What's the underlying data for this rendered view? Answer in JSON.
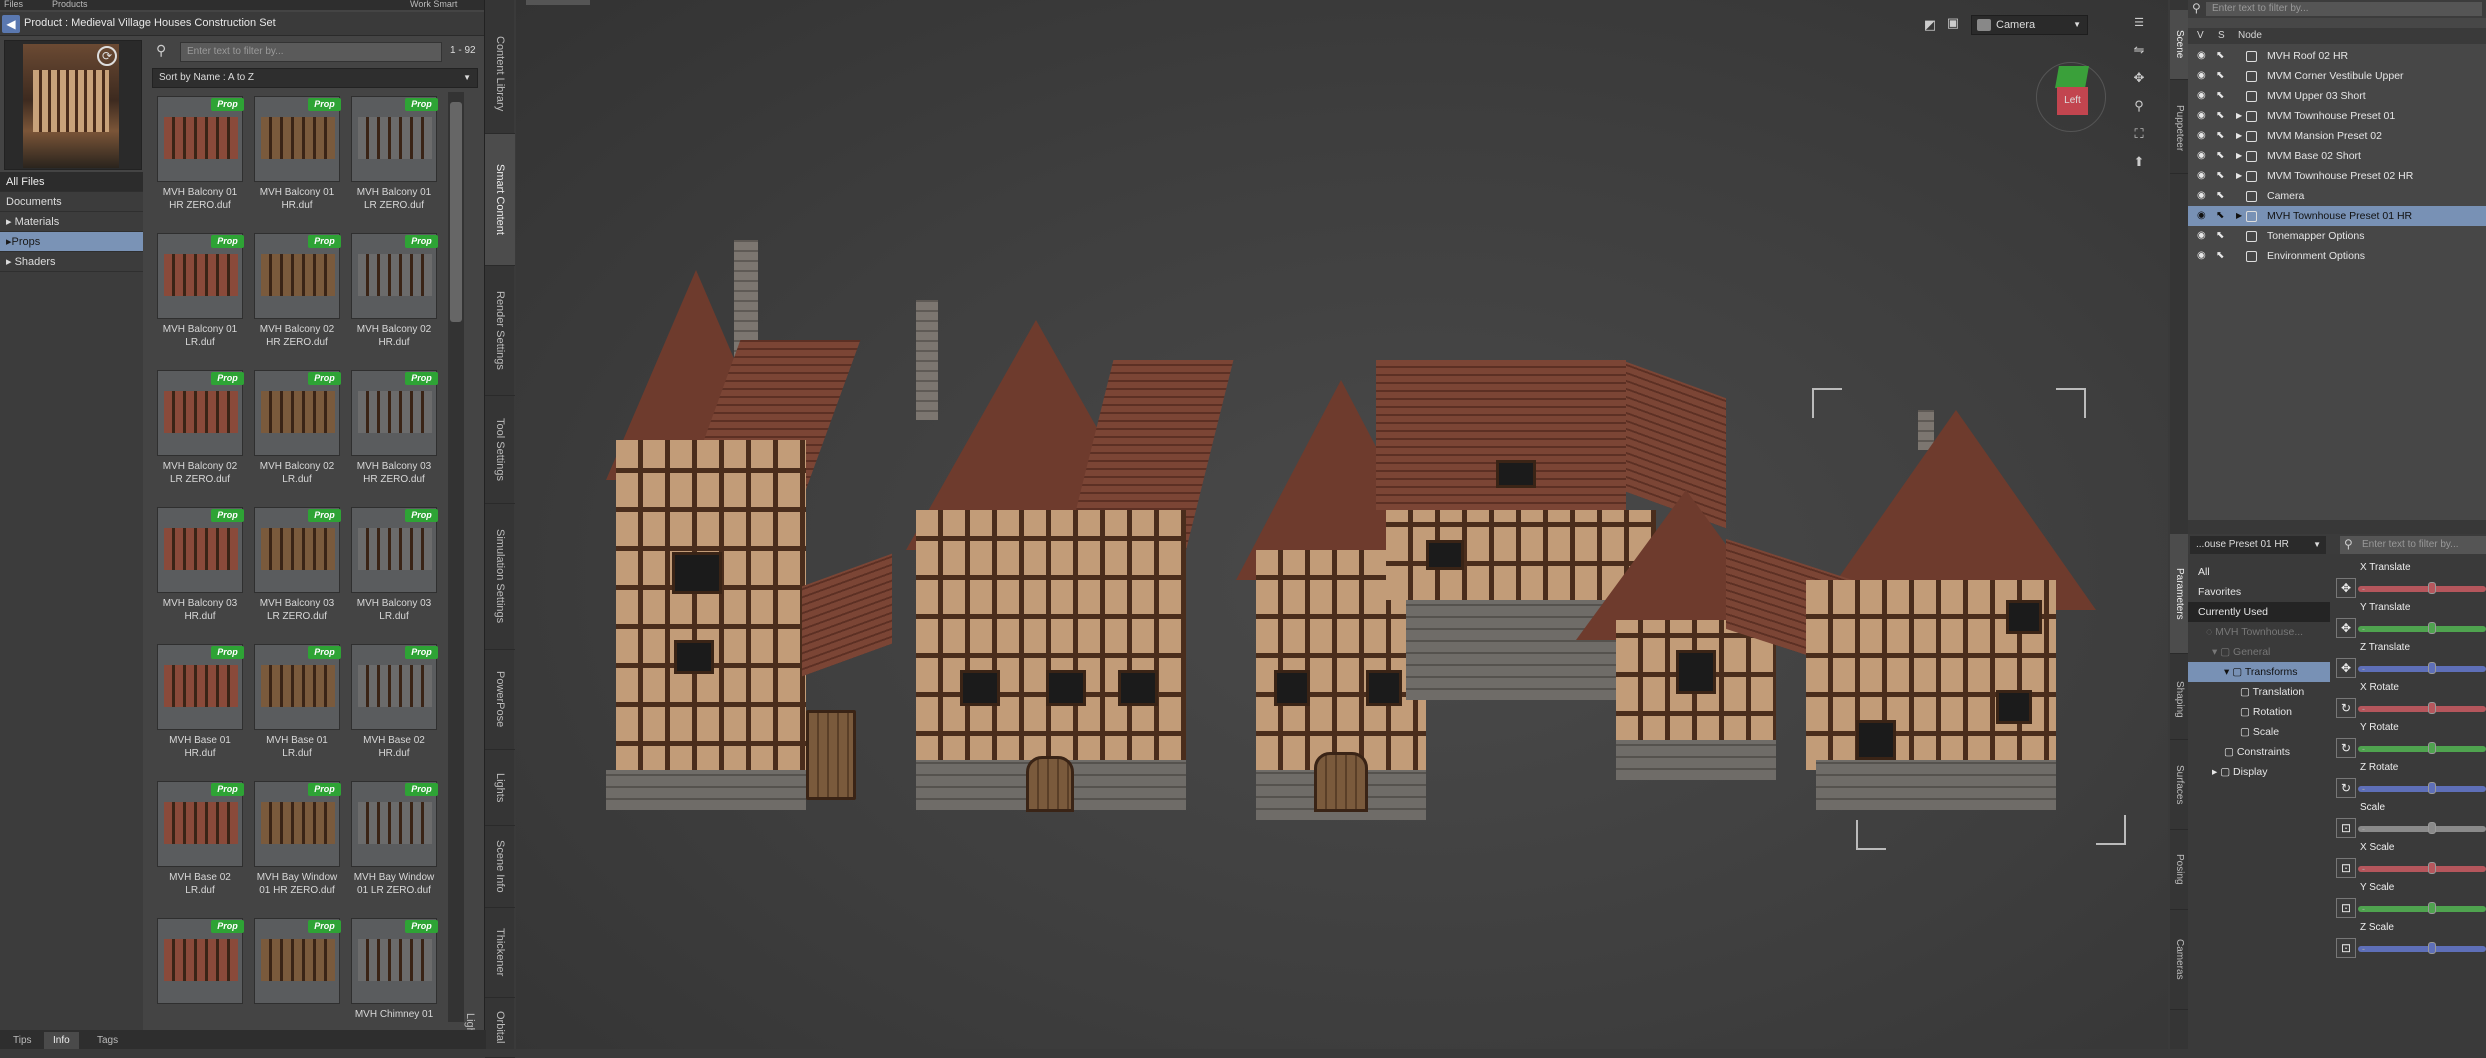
{
  "top_tabs": [
    "Files",
    "Products",
    "Work Smart"
  ],
  "product_breadcrumb": "Product : Medieval Village Houses Construction Set",
  "categories": [
    "All Files",
    "Documents",
    "Materials",
    "Props",
    "Shaders"
  ],
  "search": {
    "placeholder": "Enter text to filter by...",
    "count": "1 - 92"
  },
  "sort_label": "Sort by Name : A to Z",
  "tag_label": "Prop",
  "products": [
    {
      "l1": "MVH Balcony 01",
      "l2": "HR ZERO.duf"
    },
    {
      "l1": "MVH Balcony 01",
      "l2": "HR.duf"
    },
    {
      "l1": "MVH Balcony 01",
      "l2": "LR ZERO.duf"
    },
    {
      "l1": "MVH Balcony 01",
      "l2": "LR.duf"
    },
    {
      "l1": "MVH Balcony 02",
      "l2": "HR ZERO.duf"
    },
    {
      "l1": "MVH Balcony 02",
      "l2": "HR.duf"
    },
    {
      "l1": "MVH Balcony 02",
      "l2": "LR ZERO.duf"
    },
    {
      "l1": "MVH Balcony 02",
      "l2": "LR.duf"
    },
    {
      "l1": "MVH Balcony 03",
      "l2": "HR ZERO.duf"
    },
    {
      "l1": "MVH Balcony 03",
      "l2": "HR.duf"
    },
    {
      "l1": "MVH Balcony 03",
      "l2": "LR ZERO.duf"
    },
    {
      "l1": "MVH Balcony 03",
      "l2": "LR.duf"
    },
    {
      "l1": "MVH Base 01",
      "l2": "HR.duf"
    },
    {
      "l1": "MVH Base 01",
      "l2": "LR.duf"
    },
    {
      "l1": "MVH Base 02",
      "l2": "HR.duf"
    },
    {
      "l1": "MVH Base 02",
      "l2": "LR.duf"
    },
    {
      "l1": "MVH Bay Window",
      "l2": "01 HR ZERO.duf"
    },
    {
      "l1": "MVH Bay Window",
      "l2": "01 LR ZERO.duf"
    },
    {
      "l1": "",
      "l2": ""
    },
    {
      "l1": "",
      "l2": ""
    },
    {
      "l1": "MVH Chimney 01",
      "l2": ""
    }
  ],
  "left_vtabs": [
    "Content Library",
    "Smart Content",
    "Render Settings",
    "Tool Settings",
    "Simulation Settings",
    "PowerPose",
    "Lights",
    "Scene Info",
    "Thickener",
    "Orbital Lights"
  ],
  "bottom_tabs": [
    "Tips",
    "Info",
    "Tags"
  ],
  "viewport": {
    "camera": "Camera",
    "cube_face": "Left"
  },
  "right_vtabs_top": [
    "Scene",
    "Puppeteer"
  ],
  "right_vtabs_bottom": [
    "Parameters",
    "Shaping",
    "Surfaces",
    "Posing",
    "Cameras"
  ],
  "scene": {
    "filter_placeholder": "Enter text to filter by...",
    "col_v": "V",
    "col_s": "S",
    "col_node": "Node",
    "nodes": [
      "MVH Roof 02 HR",
      "MVM Corner Vestibule Upper",
      "MVM Upper 03 Short",
      "MVM Townhouse Preset 01",
      "MVM Mansion Preset 02",
      "MVM Base 02 Short",
      "MVM Townhouse Preset 02 HR",
      "Camera",
      "MVH Townhouse Preset 01 HR",
      "Tonemapper Options",
      "Environment Options"
    ],
    "selected_index": 8
  },
  "params": {
    "node_select": "...ouse Preset 01 HR",
    "filter_placeholder": "Enter text to filter by...",
    "tree": [
      "All",
      "Favorites",
      "Currently Used",
      "MVH Townhouse...",
      "General",
      "Transforms",
      "Translation",
      "Rotation",
      "Scale",
      "Constraints",
      "Display"
    ],
    "sliders": [
      {
        "label": "X Translate",
        "color": "#b5565c"
      },
      {
        "label": "Y Translate",
        "color": "#4fa34f"
      },
      {
        "label": "Z Translate",
        "color": "#5e6fb8"
      },
      {
        "label": "X Rotate",
        "color": "#b5565c"
      },
      {
        "label": "Y Rotate",
        "color": "#4fa34f"
      },
      {
        "label": "Z Rotate",
        "color": "#5e6fb8"
      },
      {
        "label": "Scale",
        "color": "#8a8a8a"
      },
      {
        "label": "X Scale",
        "color": "#b5565c"
      },
      {
        "label": "Y Scale",
        "color": "#4fa34f"
      },
      {
        "label": "Z Scale",
        "color": "#5e6fb8"
      }
    ]
  }
}
